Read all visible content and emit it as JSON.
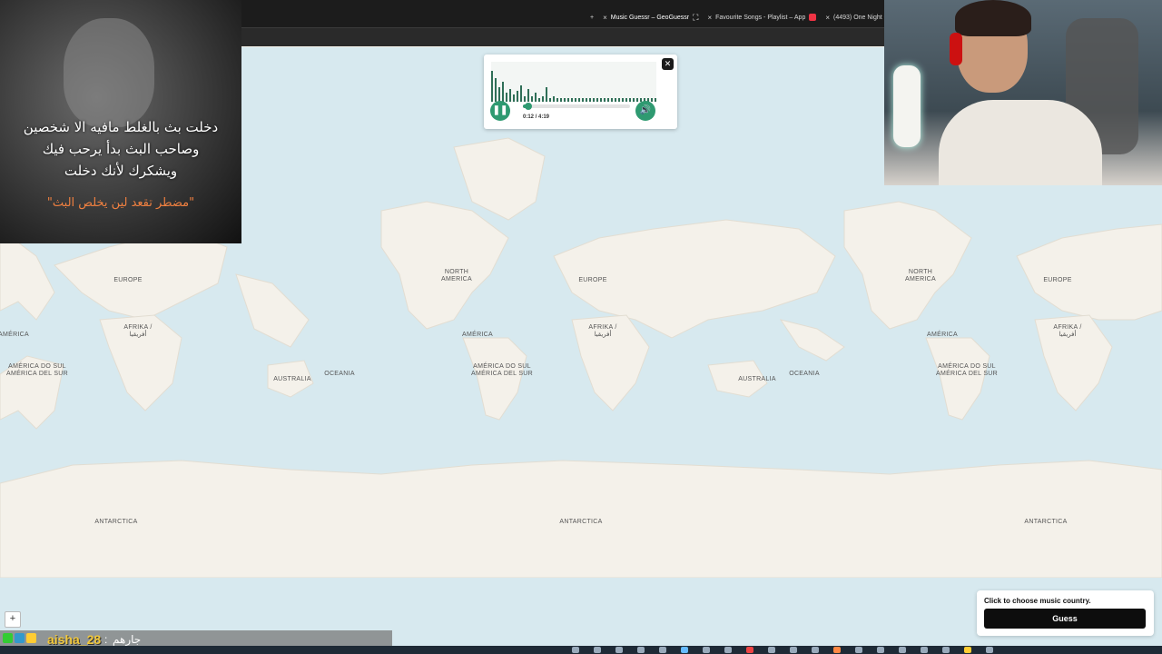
{
  "browser": {
    "tabs": [
      {
        "label": "Music Guessr – GeoGuessr",
        "active": true
      },
      {
        "label": "Favourite Songs - Playlist – App",
        "active": false
      },
      {
        "label": "(4493) One Night -",
        "active": false
      }
    ],
    "new_tab_icon": "+",
    "close_icon": "×"
  },
  "map": {
    "labels": {
      "europe": "EUROPE",
      "north_america": "NORTH AMERICA",
      "africa": "AFRIKA / أفريقيا",
      "america": "AMÉRICA",
      "south_america": "AMÉRICA DO SUL AMÉRICA DEL SUR",
      "australia": "AUSTRALIA",
      "oceania": "OCEANIA",
      "antarctica": "ANTARCTICA"
    },
    "zoom_in": "+"
  },
  "player": {
    "time": "0:12 / 4:19",
    "progress": 0.05,
    "close_icon": "close-icon",
    "play_icon": "pause-icon",
    "volume_icon": "volume-icon"
  },
  "guess": {
    "hint": "Click to choose music country.",
    "button": "Guess"
  },
  "overlay": {
    "lines": [
      "دخلت بث بالغلط مافيه الا شخصين",
      "وصاحب البث بدأ يرحب فيك",
      "ويشكرك لأنك دخلت"
    ],
    "caption": "\"مضطر تقعد لين يخلص البث\""
  },
  "chat": {
    "username": "aisha_28",
    "separator": ":",
    "message": "جارهم"
  },
  "colors": {
    "accent": "#2f9a71",
    "water": "#d7e9ef",
    "land": "#f4f1ea"
  }
}
